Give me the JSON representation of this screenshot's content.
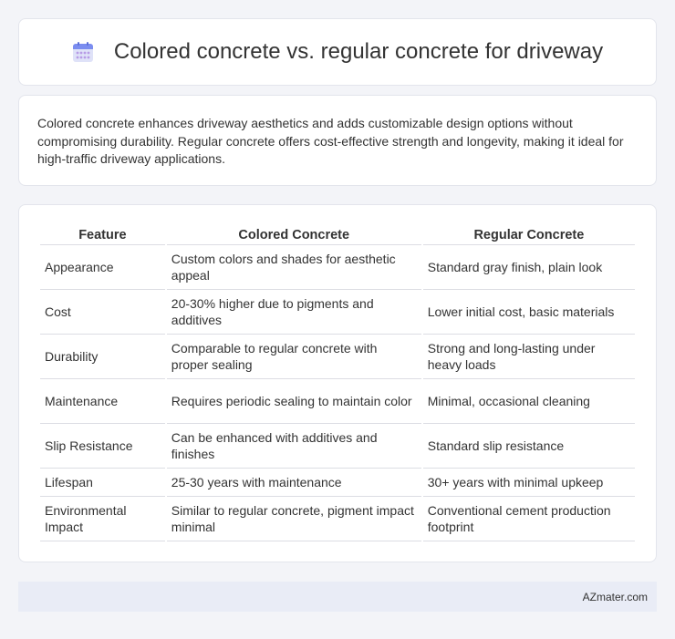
{
  "header": {
    "title": "Colored concrete vs. regular concrete for driveway",
    "icon": "calendar-icon",
    "icon_colors": {
      "top": "#7b8df0",
      "body": "#d9dcf7",
      "dots": "#b79be6"
    }
  },
  "summary": {
    "text": "Colored concrete enhances driveway aesthetics and adds customizable design options without compromising durability. Regular concrete offers cost-effective strength and longevity, making it ideal for high-traffic driveway applications."
  },
  "table": {
    "headers": [
      "Feature",
      "Colored Concrete",
      "Regular Concrete"
    ],
    "rows": [
      [
        "Appearance",
        "Custom colors and shades for aesthetic appeal",
        "Standard gray finish, plain look"
      ],
      [
        "Cost",
        "20-30% higher due to pigments and additives",
        "Lower initial cost, basic materials"
      ],
      [
        "Durability",
        "Comparable to regular concrete with proper sealing",
        "Strong and long-lasting under heavy loads"
      ],
      [
        "Maintenance",
        "Requires periodic sealing to maintain color",
        "Minimal, occasional cleaning"
      ],
      [
        "Slip Resistance",
        "Can be enhanced with additives and finishes",
        "Standard slip resistance"
      ],
      [
        "Lifespan",
        "25-30 years with maintenance",
        "30+ years with minimal upkeep"
      ],
      [
        "Environmental Impact",
        "Similar to regular concrete, pigment impact minimal",
        "Conventional cement production footprint"
      ]
    ]
  },
  "footer": {
    "brand": "AZmater.com"
  }
}
